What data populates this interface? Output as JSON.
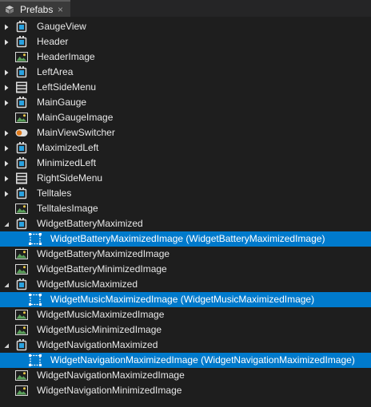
{
  "panel": {
    "tab_label": "Prefabs",
    "tab_icon": "prefab-cube-icon",
    "close_glyph": "×"
  },
  "colors": {
    "background": "#1e1e1e",
    "selection": "#007acc",
    "text": "#e8e8e8"
  },
  "items": [
    {
      "label": "GaugeView",
      "icon": "widget-icon",
      "caret": "collapsed",
      "indent": 0
    },
    {
      "label": "Header",
      "icon": "widget-icon",
      "caret": "collapsed",
      "indent": 0
    },
    {
      "label": "HeaderImage",
      "icon": "image-icon",
      "caret": "none",
      "indent": 0
    },
    {
      "label": "LeftArea",
      "icon": "widget-icon",
      "caret": "collapsed",
      "indent": 0
    },
    {
      "label": "LeftSideMenu",
      "icon": "menu-icon",
      "caret": "collapsed",
      "indent": 0
    },
    {
      "label": "MainGauge",
      "icon": "widget-icon",
      "caret": "collapsed",
      "indent": 0
    },
    {
      "label": "MainGaugeImage",
      "icon": "image-icon",
      "caret": "none",
      "indent": 0
    },
    {
      "label": "MainViewSwitcher",
      "icon": "toggle-switch-icon",
      "caret": "collapsed",
      "indent": 0
    },
    {
      "label": "MaximizedLeft",
      "icon": "widget-icon",
      "caret": "collapsed",
      "indent": 0
    },
    {
      "label": "MinimizedLeft",
      "icon": "widget-icon",
      "caret": "collapsed",
      "indent": 0
    },
    {
      "label": "RightSideMenu",
      "icon": "menu-icon",
      "caret": "collapsed",
      "indent": 0
    },
    {
      "label": "Telltales",
      "icon": "widget-icon",
      "caret": "collapsed",
      "indent": 0
    },
    {
      "label": "TelltalesImage",
      "icon": "image-icon",
      "caret": "none",
      "indent": 0
    },
    {
      "label": "WidgetBatteryMaximized",
      "icon": "widget-icon",
      "caret": "expanded",
      "indent": 0
    },
    {
      "label": "WidgetBatteryMaximizedImage (WidgetBatteryMaximizedImage)",
      "icon": "image-placeholder-icon",
      "caret": "none",
      "indent": 1,
      "selected": true
    },
    {
      "label": "WidgetBatteryMaximizedImage",
      "icon": "image-icon",
      "caret": "none",
      "indent": 0
    },
    {
      "label": "WidgetBatteryMinimizedImage",
      "icon": "image-icon",
      "caret": "none",
      "indent": 0
    },
    {
      "label": "WidgetMusicMaximized",
      "icon": "widget-icon",
      "caret": "expanded",
      "indent": 0
    },
    {
      "label": "WidgetMusicMaximizedImage (WidgetMusicMaximizedImage)",
      "icon": "image-placeholder-icon",
      "caret": "none",
      "indent": 1,
      "selected": true
    },
    {
      "label": "WidgetMusicMaximizedImage",
      "icon": "image-icon",
      "caret": "none",
      "indent": 0
    },
    {
      "label": "WidgetMusicMinimizedImage",
      "icon": "image-icon",
      "caret": "none",
      "indent": 0
    },
    {
      "label": "WidgetNavigationMaximized",
      "icon": "widget-icon",
      "caret": "expanded",
      "indent": 0
    },
    {
      "label": "WidgetNavigationMaximizedImage (WidgetNavigationMaximizedImage)",
      "icon": "image-placeholder-icon",
      "caret": "none",
      "indent": 1,
      "selected": true
    },
    {
      "label": "WidgetNavigationMaximizedImage",
      "icon": "image-icon",
      "caret": "none",
      "indent": 0
    },
    {
      "label": "WidgetNavigationMinimizedImage",
      "icon": "image-icon",
      "caret": "none",
      "indent": 0
    }
  ]
}
